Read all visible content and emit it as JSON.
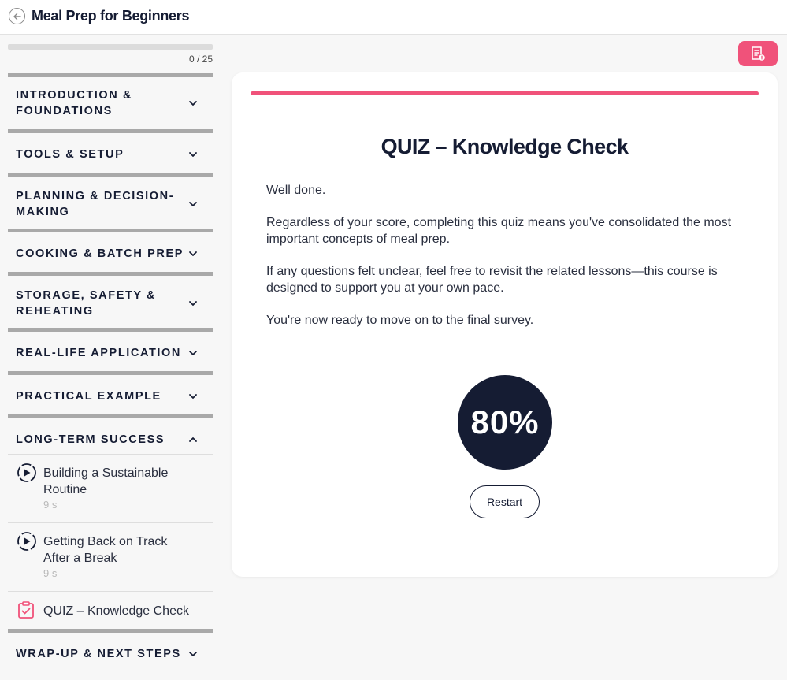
{
  "header": {
    "title": "Meal Prep for Beginners",
    "back_icon": "back-arrow-icon"
  },
  "sidebar": {
    "progress": {
      "text": "0 / 25",
      "fraction": 0
    },
    "sections": [
      {
        "label": "INTRODUCTION & FOUNDATIONS",
        "expanded": false
      },
      {
        "label": "TOOLS & SETUP",
        "expanded": false
      },
      {
        "label": "PLANNING & DECISION-MAKING",
        "expanded": false
      },
      {
        "label": "COOKING & BATCH PREP",
        "expanded": false
      },
      {
        "label": "STORAGE, SAFETY & REHEATING",
        "expanded": false
      },
      {
        "label": "REAL-LIFE APPLICATION",
        "expanded": false
      },
      {
        "label": "PRACTICAL EXAMPLE",
        "expanded": false
      },
      {
        "label": "LONG-TERM SUCCESS",
        "expanded": true
      },
      {
        "label": "WRAP-UP & NEXT STEPS",
        "expanded": false
      }
    ],
    "lessons": [
      {
        "title": "Building a Sustainable Routine",
        "duration": "9 s",
        "icon": "video-play-icon"
      },
      {
        "title": "Getting Back on Track After a Break",
        "duration": "9 s",
        "icon": "video-play-icon"
      },
      {
        "title": "QUIZ – Knowledge Check",
        "icon": "quiz-checklist-icon"
      }
    ]
  },
  "toolbar": {
    "notes_icon": "notes-icon"
  },
  "main": {
    "title": "QUIZ – Knowledge Check",
    "paragraphs": [
      "Well done.",
      "Regardless of your score, completing this quiz means you've consolidated the most important concepts of meal prep.",
      "If any questions felt unclear, feel free to revisit the related lessons—this course is designed to support you at your own pace.",
      "You're now ready to move on to the final survey."
    ],
    "score": "80%",
    "restart_label": "Restart"
  },
  "colors": {
    "accent": "#f0527a",
    "navy": "#151c33",
    "background": "#f7f7f7"
  }
}
